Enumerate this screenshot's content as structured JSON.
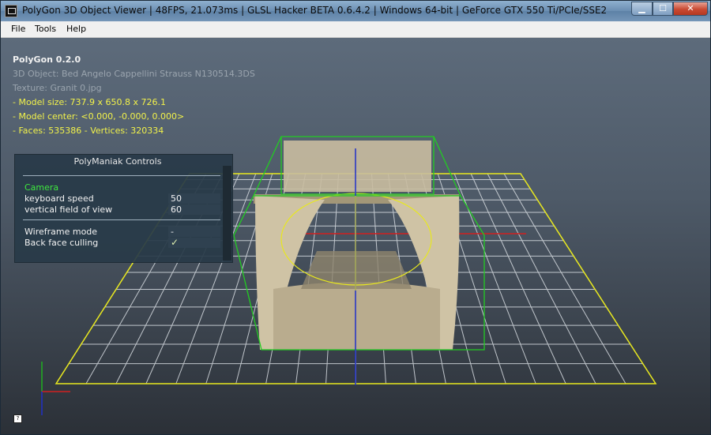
{
  "window": {
    "title": "PolyGon 3D Object Viewer | 48FPS, 21.073ms | GLSL Hacker BETA 0.6.4.2 | Windows 64-bit | GeForce GTX 550 Ti/PCIe/SSE2",
    "minimize_glyph": "▁",
    "maximize_glyph": "☐",
    "close_glyph": "✕"
  },
  "menu": {
    "items": [
      "File",
      "Tools",
      "Help"
    ]
  },
  "hud": {
    "app_name": "PolyGon 0.2.0",
    "object": "3D Object: Bed Angelo Cappellini Strauss N130514.3DS",
    "texture": "Texture: Granit 0.jpg",
    "model_size": "- Model size:  737.9 x 650.8 x 726.1",
    "model_center": "- Model center:  <0.000, -0.000, 0.000>",
    "faces_vertices": "- Faces: 535386 - Vertices: 320334"
  },
  "controls": {
    "title": "PolyManiak Controls",
    "section": "Camera",
    "keyboard_speed_label": "keyboard speed",
    "keyboard_speed_value": "50",
    "fov_label": "vertical field of view",
    "fov_value": "60",
    "wireframe_label": "Wireframe mode",
    "wireframe_value": "-",
    "backface_label": "Back face culling",
    "backface_value": "✓"
  },
  "help_button": "?",
  "colors": {
    "grid": "#d8dde2",
    "plane_border": "#e8e81e",
    "bbox": "#22cc22",
    "axis_x": "#d02020",
    "axis_y": "#20b020",
    "axis_z": "#2030c8",
    "hud_yellow": "#f2f24a"
  }
}
